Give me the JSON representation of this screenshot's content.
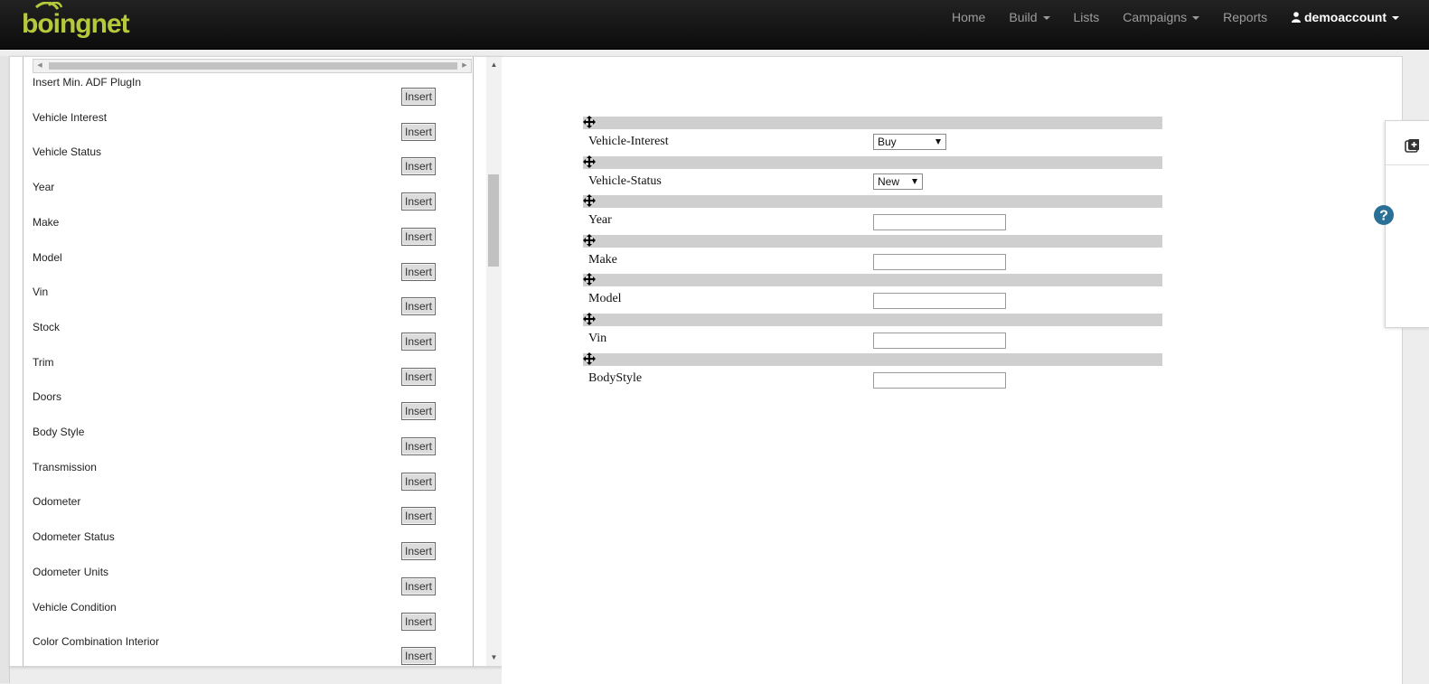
{
  "brand": {
    "logo_text": "boingnet",
    "accent": "#b5c93a",
    "navbar_bg": "#111111"
  },
  "nav": {
    "items": [
      {
        "label": "Home",
        "dropdown": false
      },
      {
        "label": "Build",
        "dropdown": true
      },
      {
        "label": "Lists",
        "dropdown": false
      },
      {
        "label": "Campaigns",
        "dropdown": true
      },
      {
        "label": "Reports",
        "dropdown": false
      }
    ],
    "account": {
      "label": "demoaccount",
      "icon": "user-icon"
    }
  },
  "field_panel": {
    "insert_label": "Insert",
    "fields": [
      "Insert Min. ADF PlugIn",
      "Vehicle Interest",
      "Vehicle Status",
      "Year",
      "Make",
      "Model",
      "Vin",
      "Stock",
      "Trim",
      "Doors",
      "Body Style",
      "Transmission",
      "Odometer",
      "Odometer Status",
      "Odometer Units",
      "Vehicle Condition",
      "Color Combination Interior"
    ]
  },
  "form": {
    "fields": [
      {
        "label": "Vehicle-Interest",
        "type": "select",
        "value": "Buy"
      },
      {
        "label": "Vehicle-Status",
        "type": "select",
        "value": "New"
      },
      {
        "label": "Year",
        "type": "text",
        "value": ""
      },
      {
        "label": "Make",
        "type": "text",
        "value": ""
      },
      {
        "label": "Model",
        "type": "text",
        "value": ""
      },
      {
        "label": "Vin",
        "type": "text",
        "value": ""
      },
      {
        "label": "BodyStyle",
        "type": "text",
        "value": ""
      }
    ]
  },
  "icons": {
    "move": "move-arrows-icon",
    "help": "help-icon",
    "side_tab": "add-element-icon"
  },
  "colors": {
    "help_blue": "#2a6f95",
    "drag_bar": "#cfcfcf"
  }
}
